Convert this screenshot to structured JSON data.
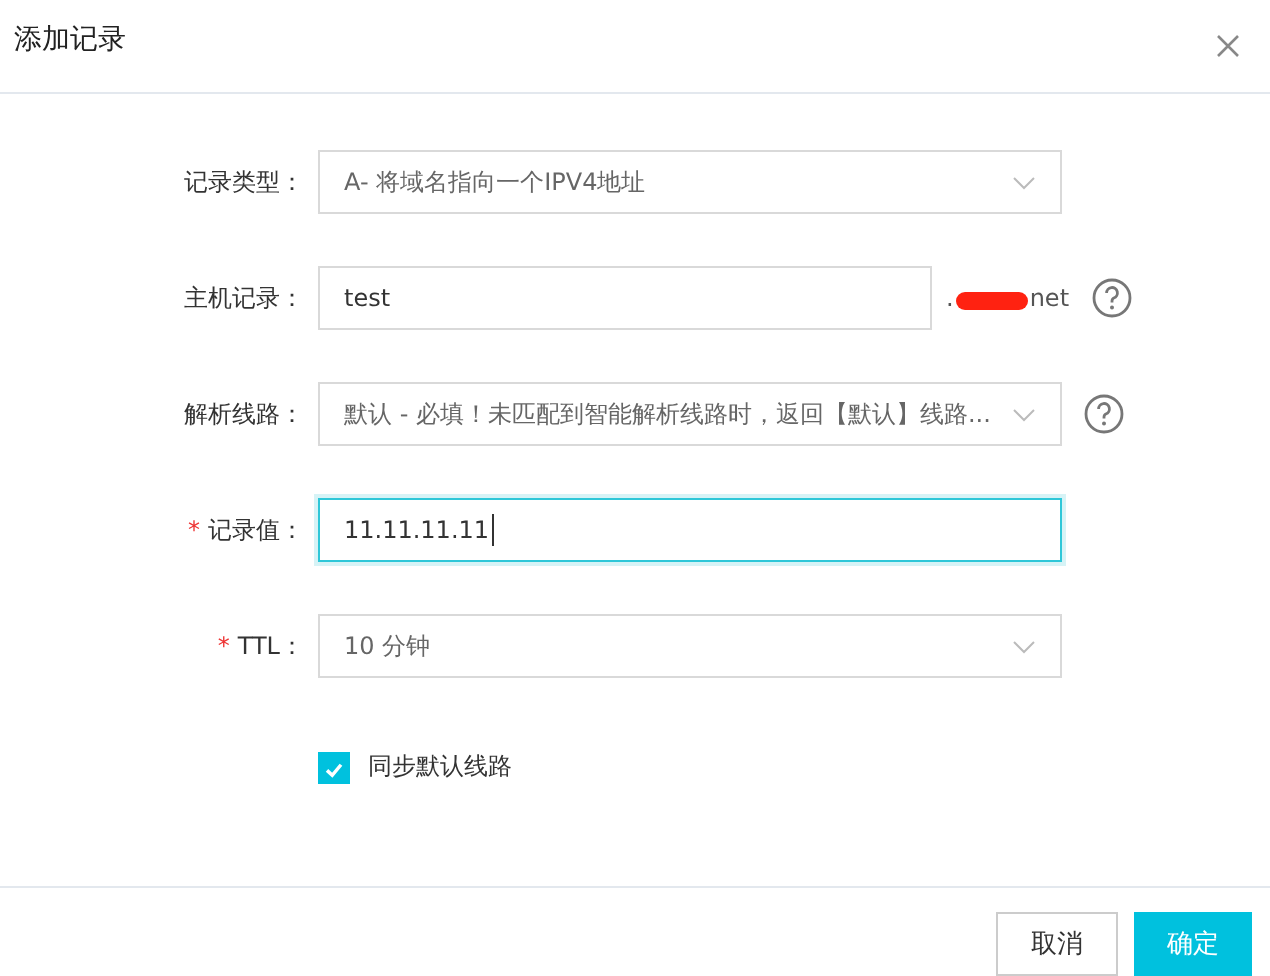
{
  "dialog": {
    "title": "添加记录"
  },
  "fields": [
    {
      "kind": "select",
      "label": "记录类型：",
      "value": "A- 将域名指向一个IPV4地址",
      "help": false,
      "focused": false
    },
    {
      "kind": "input",
      "label": "主机记录：",
      "value": "test",
      "suffix_start": ".",
      "suffix_end": "net",
      "help": true,
      "focused": false
    },
    {
      "kind": "select",
      "label": "解析线路：",
      "value": "默认 - 必填！未匹配到智能解析线路时，返回【默认】线路...",
      "help": true,
      "focused": false
    },
    {
      "kind": "input",
      "required_mark": "*",
      "label": "记录值：",
      "value": "11.11.11.11",
      "help": false,
      "focused": true
    },
    {
      "kind": "select",
      "required_mark": "*",
      "label": "TTL：",
      "value": "10 分钟",
      "help": false,
      "focused": false
    }
  ],
  "sync_checkbox": {
    "label": "同步默认线路",
    "checked": true
  },
  "buttons": [
    {
      "label": "取消",
      "kind": "secondary"
    },
    {
      "label": "确定",
      "kind": "primary"
    }
  ]
}
